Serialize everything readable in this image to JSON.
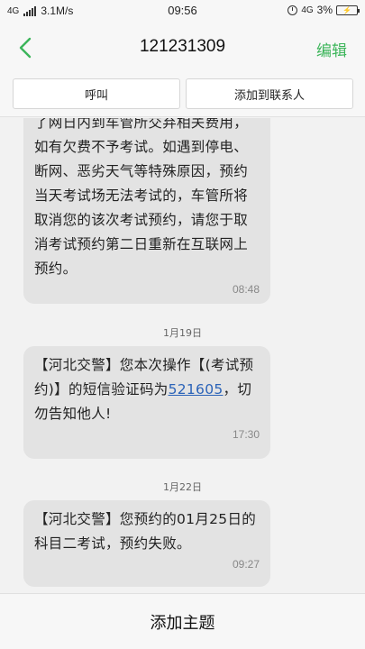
{
  "status_bar": {
    "network": "4G",
    "speed": "3.1M/s",
    "time": "09:56",
    "network_right": "4G",
    "battery": "3%"
  },
  "header": {
    "back_icon": "chevron-left-icon",
    "title": "121231309",
    "edit_label": "编辑"
  },
  "actions": {
    "call_label": "呼叫",
    "add_contact_label": "添加到联系人"
  },
  "messages": [
    {
      "text": "了网日内到车管所交弃相关费用，如有欠费不予考试。如遇到停电、断网、恶劣天气等特殊原因，预约当天考试场无法考试的，车管所将取消您的该次考试预约，请您于取消考试预约第二日重新在互联网上预约。",
      "time": "08:48"
    },
    {
      "date": "1月19日",
      "text_before": "【河北交警】您本次操作【(考试预约)】的短信验证码为",
      "code": "521605",
      "text_after": "，切勿告知他人!",
      "time": "17:30"
    },
    {
      "date": "1月22日",
      "text": "【河北交警】您预约的01月25日的科目二考试，预约失败。",
      "time": "09:27"
    }
  ],
  "bottom": {
    "add_subject_label": "添加主题"
  },
  "colors": {
    "accent": "#3cb55a",
    "bubble": "#e3e3e3",
    "link": "#2b63b8"
  }
}
